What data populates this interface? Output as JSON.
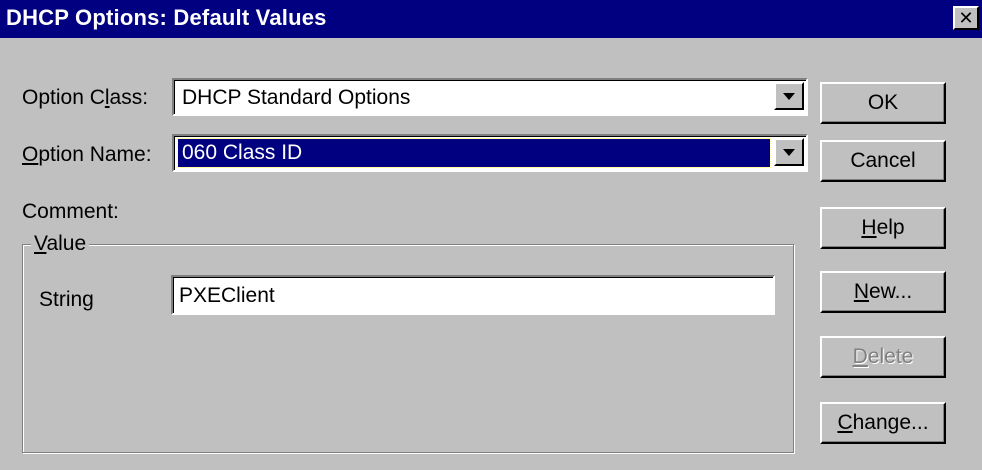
{
  "window": {
    "title": "DHCP Options: Default Values",
    "close_glyph": "✕"
  },
  "fields": {
    "option_class": {
      "label_pre": "Option C",
      "label_accel": "l",
      "label_post": "ass:",
      "value": "DHCP Standard Options"
    },
    "option_name": {
      "label_accel": "O",
      "label_post": "ption Name:",
      "value": "060 Class ID"
    },
    "comment": {
      "label": "Comment:"
    }
  },
  "value_group": {
    "legend_accel": "V",
    "legend_post": "alue",
    "string_label": "String",
    "string_value": "PXEClient"
  },
  "buttons": {
    "ok": {
      "label": "OK"
    },
    "cancel": {
      "label": "Cancel"
    },
    "help": {
      "accel": "H",
      "rest": "elp"
    },
    "new": {
      "accel": "N",
      "rest": "ew..."
    },
    "delete": {
      "accel": "D",
      "rest": "elete",
      "disabled": true
    },
    "change": {
      "accel": "C",
      "rest": "hange..."
    }
  },
  "icons": {
    "close": "close-icon",
    "dropdown": "chevron-down-icon"
  },
  "colors": {
    "titlebar": "#000080",
    "face": "#c0c0c0",
    "selection": "#000080"
  }
}
